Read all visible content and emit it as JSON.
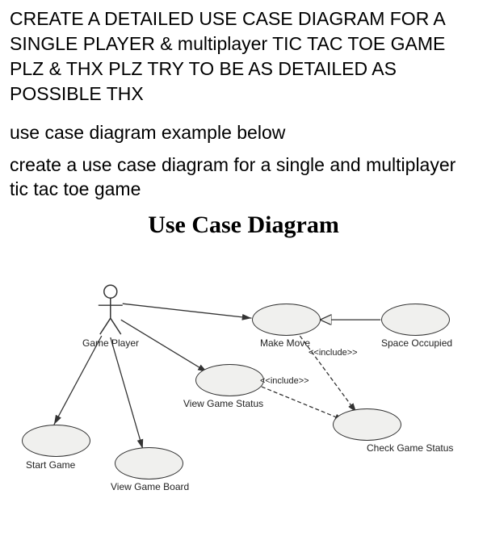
{
  "text": {
    "instruction_main": "CREATE A DETAILED USE CASE DIAGRAM FOR A SINGLE PLAYER & multiplayer TIC TAC TOE GAME PLZ & THX PLZ TRY TO BE AS DETAILED AS POSSIBLE THX",
    "instruction_sub1": "use case diagram example below",
    "instruction_sub2": "create a use case diagram for a single and multiplayer tic tac toe game",
    "diagram_title": "Use Case Diagram"
  },
  "diagram": {
    "actor": {
      "name": "Game Player"
    },
    "use_cases": {
      "start_game": "Start Game",
      "view_board": "View Game Board",
      "view_status": "View Game Status",
      "make_move": "Make Move",
      "space_occupied": "Space Occupied",
      "check_status": "Check Game Status"
    },
    "relationships": {
      "include1": "<<include>>",
      "include2": "<<include>>"
    }
  }
}
